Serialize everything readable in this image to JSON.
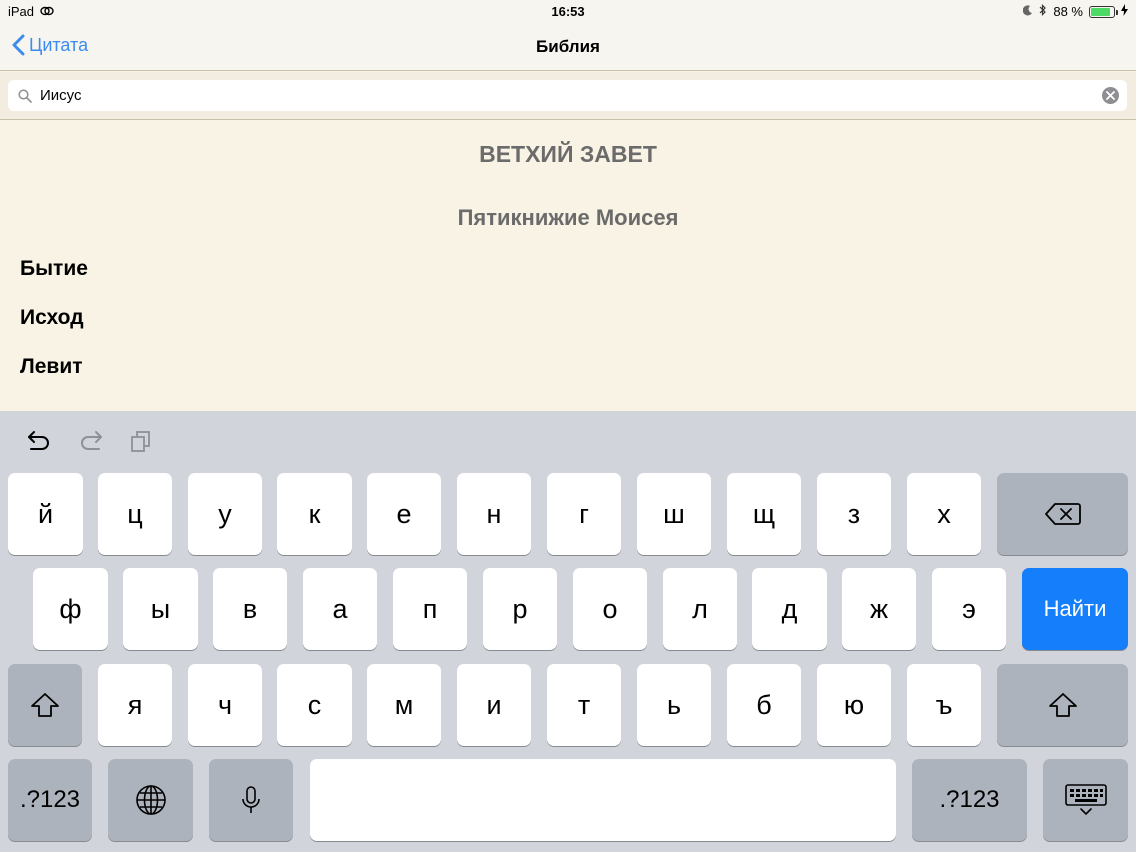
{
  "status_bar": {
    "device": "iPad",
    "time": "16:53",
    "battery": "88 %",
    "battery_level": 0.88
  },
  "nav": {
    "back_label": "Цитата",
    "title": "Библия"
  },
  "search": {
    "value": "Иисус"
  },
  "content": {
    "section": "ВЕТХИЙ ЗАВЕТ",
    "subsection": "Пятикнижие Моисея",
    "books": [
      "Бытие",
      "Исход",
      "Левит"
    ]
  },
  "keyboard": {
    "row1": [
      "й",
      "ц",
      "у",
      "к",
      "е",
      "н",
      "г",
      "ш",
      "щ",
      "з",
      "х"
    ],
    "row2": [
      "ф",
      "ы",
      "в",
      "а",
      "п",
      "р",
      "о",
      "л",
      "д",
      "ж",
      "э"
    ],
    "row3": [
      "я",
      "ч",
      "с",
      "м",
      "и",
      "т",
      "ь",
      "б",
      "ю",
      "ъ"
    ],
    "search_key": "Найти",
    "numbers_key": ".?123"
  },
  "colors": {
    "accent": "#3c8cf0",
    "search_key_bg": "#147efb",
    "content_bg": "#f8f3e4"
  },
  "icons": [
    "back-chevron-icon",
    "search-icon",
    "clear-icon",
    "undo-icon",
    "redo-icon",
    "paste-icon",
    "delete-icon",
    "shift-icon",
    "globe-icon",
    "microphone-icon",
    "keyboard-dismiss-icon",
    "moon-icon",
    "bluetooth-icon",
    "charging-icon",
    "sync-icon"
  ]
}
